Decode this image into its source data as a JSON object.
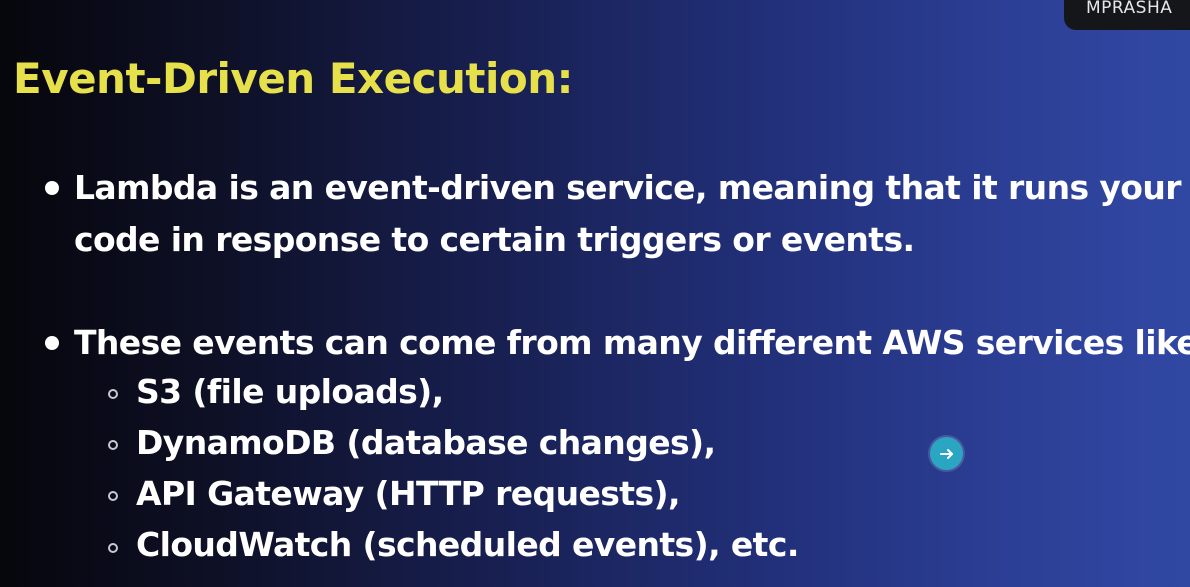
{
  "presenter": {
    "name_tag": "MPRASHA"
  },
  "slide": {
    "title": "Event-Driven Execution:",
    "bullets": [
      {
        "line1": "Lambda is an event-driven service, meaning that it runs your",
        "line2": "code in response to certain triggers or events."
      },
      {
        "line1": "These events can come from many different AWS services like"
      }
    ],
    "sub_items": [
      "S3 (file uploads),",
      "DynamoDB (database changes),",
      "API Gateway (HTTP requests),",
      "CloudWatch (scheduled events), etc."
    ]
  },
  "overlay": {
    "cursor_icon": "arrow-right-icon",
    "accent_color": "#2aa5c2"
  },
  "colors": {
    "title": "#e6e04a",
    "text": "#ffffff",
    "background_start": "#06060c",
    "background_end": "#3148a3"
  }
}
